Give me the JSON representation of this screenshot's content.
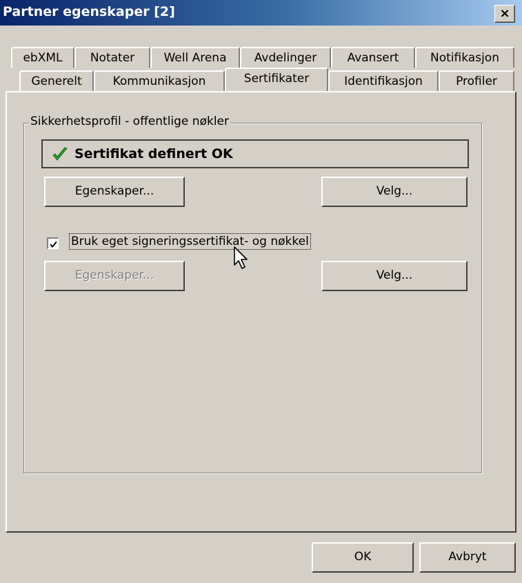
{
  "window": {
    "title": "Partner egenskaper [2]",
    "close_label": "×"
  },
  "tabs_row1": [
    {
      "label": "ebXML"
    },
    {
      "label": "Notater"
    },
    {
      "label": "Well Arena"
    },
    {
      "label": "Avdelinger"
    },
    {
      "label": "Avansert"
    },
    {
      "label": "Notifikasjon"
    }
  ],
  "tabs_row2": [
    {
      "label": "Generelt"
    },
    {
      "label": "Kommunikasjon"
    },
    {
      "label": "Sertifikater",
      "active": true
    },
    {
      "label": "Identifikasjon"
    },
    {
      "label": "Profiler"
    }
  ],
  "group": {
    "title": "Sikkerhetsprofil - offentlige nøkler",
    "status": {
      "icon": "check-icon",
      "text": "Sertifikat definert OK",
      "color": "#2e9e2e"
    },
    "properties_button": "Egenskaper...",
    "select_button": "Velg...",
    "checkbox": {
      "label": "Bruk eget signeringssertifikat- og nøkkel",
      "checked": true
    },
    "properties_button_2": {
      "label": "Egenskaper...",
      "enabled": false
    },
    "select_button_2": "Velg..."
  },
  "footer": {
    "ok_label": "OK",
    "cancel_label": "Avbryt"
  }
}
